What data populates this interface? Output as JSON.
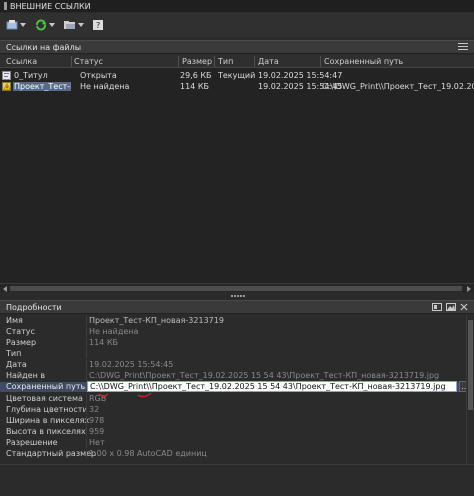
{
  "window": {
    "title": "ВНЕШНИЕ ССЫЛКИ"
  },
  "toolbar": {
    "buttons": [
      {
        "icon": "attach-icon"
      },
      {
        "icon": "refresh-icon"
      },
      {
        "icon": "folder-icon"
      },
      {
        "icon": "help-icon"
      }
    ]
  },
  "file_refs": {
    "title": "Ссылки на файлы",
    "columns": [
      "Ссылка",
      "Статус",
      "Размер",
      "Тип",
      "Дата",
      "Сохраненный путь"
    ],
    "rows": [
      {
        "name": "0_Титул",
        "status": "Открыта",
        "size": "29,6 КБ",
        "type": "Текущий",
        "date": "19.02.2025 15:54:47",
        "path": ""
      },
      {
        "name": "Проект_Тест-К...",
        "status": "Не найдена",
        "size": "114 КБ",
        "type": "",
        "date": "19.02.2025 15:54:45",
        "path": "C:\\\\DWG_Print\\\\Проект_Тест_19.02.2025 15 54 43\\\\Проект_Тест-КП_новая-3213719.jpg"
      }
    ]
  },
  "details": {
    "title": "Подробности",
    "rows": [
      {
        "label": "Имя",
        "value": "Проект_Тест-КП_новая-3213719"
      },
      {
        "label": "Статус",
        "value": "Не найдена"
      },
      {
        "label": "Размер",
        "value": "114 КБ"
      },
      {
        "label": "Тип",
        "value": ""
      },
      {
        "label": "Дата",
        "value": "19.02.2025 15:54:45"
      },
      {
        "label": "Найден в",
        "value": "C:\\DWG_Print\\Проект_Тест_19.02.2025 15 54 43\\Проект_Тест-КП_новая-3213719.jpg"
      },
      {
        "label": "Сохраненный путь",
        "value": "C:\\\\DWG_Print\\\\Проект_Тест_19.02.2025 15 54 43\\Проект_Тест-КП_новая-3213719.jpg"
      },
      {
        "label": "Цветовая система",
        "value": "RGB"
      },
      {
        "label": "Глубина цветности",
        "value": "32"
      },
      {
        "label": "Ширина в пикселях",
        "value": "978"
      },
      {
        "label": "Высота в пикселях",
        "value": "959"
      },
      {
        "label": "Разрешение",
        "value": "Нет"
      },
      {
        "label": "Стандартный размер",
        "value": "1.00 x 0.98 AutoCAD единиц"
      }
    ],
    "browse_label": "..."
  },
  "colors": {
    "selection": "#586a8a",
    "highlight_row": "#3e4b62",
    "annotation_red": "#d82020"
  }
}
